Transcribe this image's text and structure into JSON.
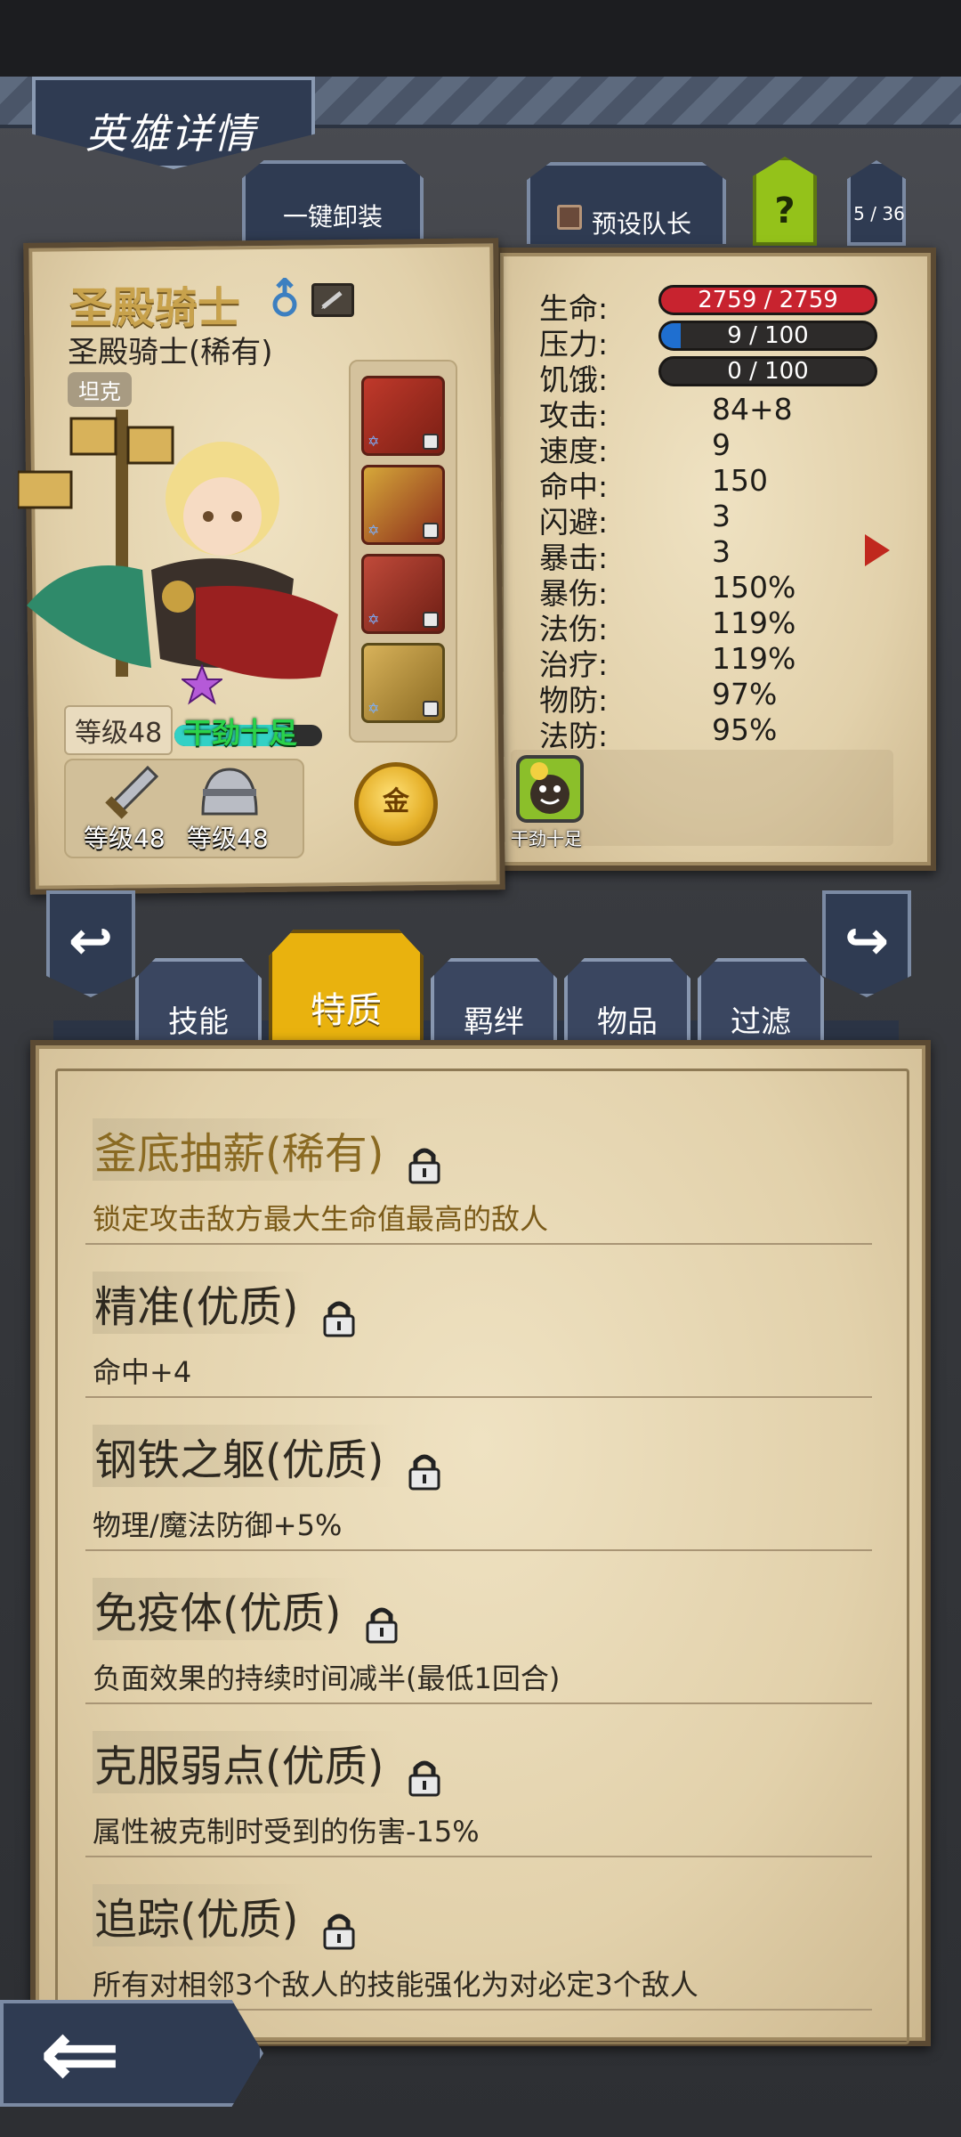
{
  "header": {
    "title": "英雄详情",
    "unequip_all": "一键卸装",
    "set_leader": "预设队长",
    "help": "?",
    "page_counter": "5 / 36"
  },
  "hero": {
    "name": "圣殿骑士",
    "subtitle": "圣殿骑士(稀有)",
    "role": "坦克",
    "level": "等级48",
    "mood": "干劲十足",
    "mood_level": 0.8,
    "weapon_level": "等级48",
    "armor_level": "等级48",
    "gold_label": "金"
  },
  "stats": {
    "hp_label": "生命:",
    "hp_value": "2759 / 2759",
    "hp_fill": 1.0,
    "stress_label": "压力:",
    "stress_value": "9 / 100",
    "stress_fill": 0.09,
    "hunger_label": "饥饿:",
    "hunger_value": "0 / 100",
    "hunger_fill": 0.0,
    "rows": [
      {
        "label": "攻击:",
        "value": "84+8"
      },
      {
        "label": "速度:",
        "value": "9"
      },
      {
        "label": "命中:",
        "value": "150"
      },
      {
        "label": "闪避:",
        "value": "3"
      },
      {
        "label": "暴击:",
        "value": "3"
      },
      {
        "label": "暴伤:",
        "value": "150%"
      },
      {
        "label": "法伤:",
        "value": "119%"
      },
      {
        "label": "治疗:",
        "value": "119%"
      },
      {
        "label": "物防:",
        "value": "97%"
      },
      {
        "label": "法防:",
        "value": "95%"
      }
    ],
    "trait_icon_label": "干劲十足"
  },
  "tabs": {
    "skills": "技能",
    "traits": "特质",
    "bonds": "羁绊",
    "items": "物品",
    "filter": "过滤"
  },
  "traits": [
    {
      "title": "釜底抽薪(稀有)",
      "desc": "锁定攻击敌方最大生命值最高的敌人",
      "rare": true
    },
    {
      "title": "精准(优质)",
      "desc": "命中+4",
      "rare": false
    },
    {
      "title": "钢铁之躯(优质)",
      "desc": "物理/魔法防御+5%",
      "rare": false
    },
    {
      "title": "免疫体(优质)",
      "desc": "负面效果的持续时间减半(最低1回合)",
      "rare": false
    },
    {
      "title": "克服弱点(优质)",
      "desc": "属性被克制时受到的伤害-15%",
      "rare": false
    },
    {
      "title": "追踪(优质)",
      "desc": "所有对相邻3个敌人的技能强化为对必定3个敌人",
      "rare": false
    }
  ],
  "colors": {
    "accent_gold": "#e9b20e",
    "hp_red": "#c8232f",
    "stress_blue": "#1f6fd0",
    "vigor_green": "#2bd24a"
  }
}
